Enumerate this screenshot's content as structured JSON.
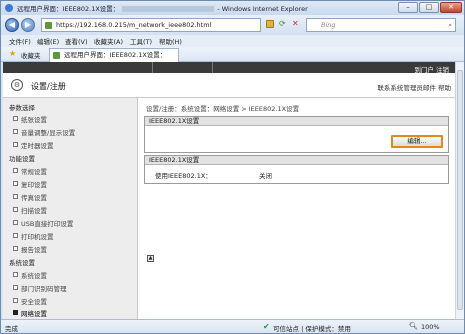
{
  "window": {
    "title": "远程用户界面：IEEE802.1X设置：",
    "app": "Windows Internet Explorer",
    "controls": [
      "–",
      "□",
      "✕"
    ]
  },
  "address": {
    "url": "https://192.168.0.215/m_network_ieee802.html",
    "search_placeholder": "Bing",
    "back_symbol": "◀",
    "forward_symbol": "▶"
  },
  "menu": [
    "文件(F)",
    "编辑(E)",
    "查看(V)",
    "收藏夹(A)",
    "工具(T)",
    "帮助(H)"
  ],
  "favorites": {
    "label": "收藏夹",
    "tab_title": "远程用户界面：IEEE802.1X设置："
  },
  "page": {
    "topbar_right": "到门户  注销",
    "header_title": "设置/注册",
    "header_links": "联系系统管理员邮件  帮助",
    "sidebar": [
      {
        "type": "section",
        "label": "参数选择"
      },
      {
        "type": "item",
        "label": "纸张设置"
      },
      {
        "type": "item",
        "label": "音量调整/显示设置"
      },
      {
        "type": "item",
        "label": "定时器设置"
      },
      {
        "type": "section",
        "label": "功能设置"
      },
      {
        "type": "item",
        "label": "常规设置"
      },
      {
        "type": "item",
        "label": "复印设置"
      },
      {
        "type": "item",
        "label": "传真设置"
      },
      {
        "type": "item",
        "label": "扫描设置"
      },
      {
        "type": "item",
        "label": "USB直接打印设置"
      },
      {
        "type": "item",
        "label": "打印机设置"
      },
      {
        "type": "item",
        "label": "报告设置"
      },
      {
        "type": "section",
        "label": "系统设置"
      },
      {
        "type": "item",
        "label": "系统设置"
      },
      {
        "type": "item",
        "label": "部门识别码管理"
      },
      {
        "type": "item",
        "label": "安全设置"
      },
      {
        "type": "item",
        "label": "网络设置",
        "active": true
      }
    ],
    "breadcrumb": "设置/注册：系统设置：网络设置 > IEEE802.1X设置",
    "box1_title": "IEEE802.1X设置",
    "edit_button": "编辑...",
    "box2_title": "IEEE802.1X设置",
    "setting_label": "使用IEEE802.1X：",
    "setting_value": "关闭",
    "top_icon": "▲"
  },
  "status": {
    "left": "完成",
    "trusted": "可信站点 | 保护模式：禁用",
    "zoom": "100%"
  }
}
